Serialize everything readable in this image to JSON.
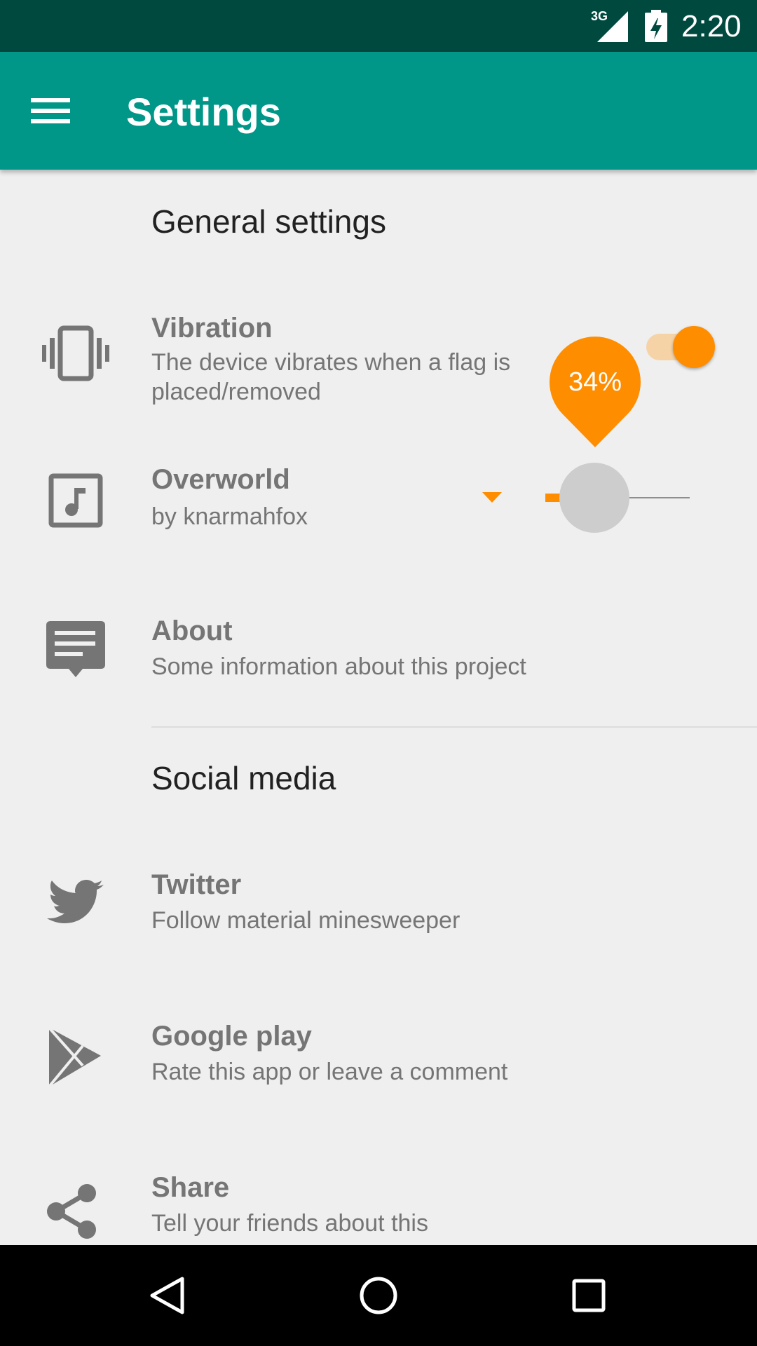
{
  "status_bar": {
    "network": "3G",
    "time": "2:20"
  },
  "app_bar": {
    "title": "Settings"
  },
  "sections": {
    "general": "General settings",
    "social": "Social media"
  },
  "settings": {
    "vibration": {
      "title": "Vibration",
      "subtitle_line1": "The device vibrates when a flag is",
      "subtitle_line2": "placed/removed",
      "enabled": true
    },
    "music": {
      "title": "Overworld",
      "subtitle": "by knarmahfox",
      "volume_label": "34%",
      "volume_fraction": 0.34
    },
    "about": {
      "title": "About",
      "subtitle": "Some information about this project"
    }
  },
  "social": {
    "twitter": {
      "title": "Twitter",
      "subtitle": "Follow material minesweeper"
    },
    "google_play": {
      "title": "Google play",
      "subtitle": "Rate this app or leave a comment"
    },
    "share": {
      "title": "Share",
      "subtitle": "Tell your friends about this"
    }
  },
  "colors": {
    "accent": "#ff8d00",
    "primary": "#009788",
    "primary_dark": "#00493f",
    "background": "#efefef",
    "icon_gray": "#757575"
  },
  "icons": {
    "menu": "hamburger-menu-icon",
    "vibration": "vibration-icon",
    "music": "music-note-icon",
    "about": "feedback-icon",
    "twitter": "twitter-bird-icon",
    "google_play": "play-store-icon",
    "share": "share-icon",
    "back": "back-triangle-icon",
    "home": "home-circle-icon",
    "recents": "recents-square-icon"
  }
}
